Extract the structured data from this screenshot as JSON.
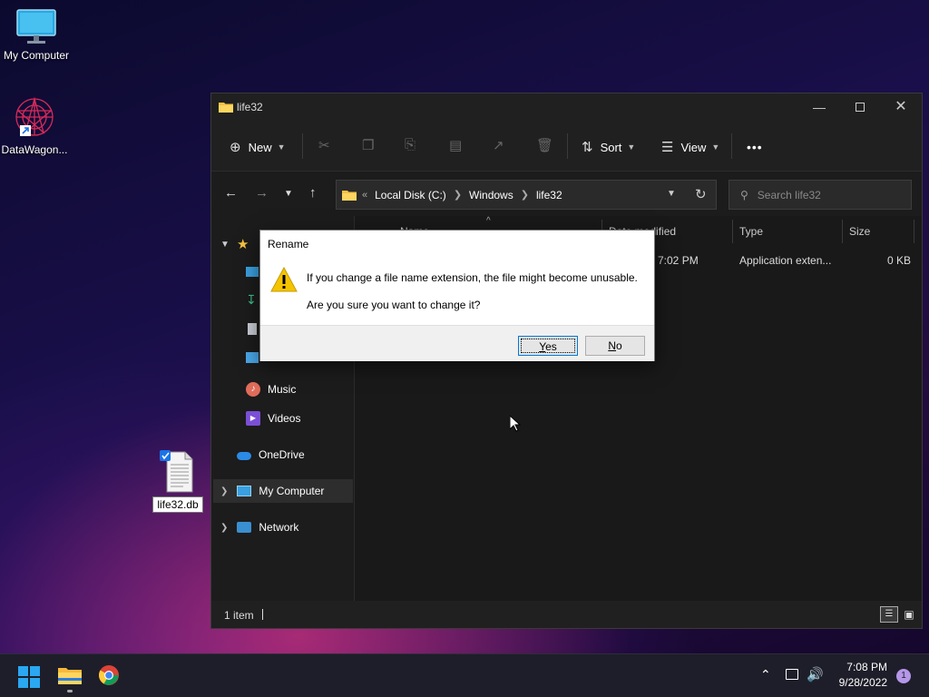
{
  "desktop": {
    "icons": [
      {
        "label": "My Computer"
      },
      {
        "label": "DataWagon..."
      },
      {
        "label": "life32.db"
      }
    ]
  },
  "explorer": {
    "title": "life32",
    "toolbar": {
      "new_label": "New",
      "sort_label": "Sort",
      "view_label": "View",
      "more_label": "•••"
    },
    "address": {
      "overflow": "«",
      "parts": [
        "Local Disk (C:)",
        "Windows",
        "life32"
      ]
    },
    "search": {
      "placeholder": "Search life32"
    },
    "nav": {
      "items": [
        "Music",
        "Videos",
        "OneDrive",
        "My Computer",
        "Network"
      ]
    },
    "columns": [
      "Name",
      "Date modified",
      "Type",
      "Size"
    ],
    "rows": [
      {
        "date": "7:02 PM",
        "type": "Application exten...",
        "size": "0 KB"
      }
    ],
    "status": {
      "count": "1 item"
    }
  },
  "dialog": {
    "title": "Rename",
    "message": "If you change a file name extension, the file might become unusable.",
    "question": "Are you sure you want to change it?",
    "yes_accel": "Y",
    "yes_rest": "es",
    "no_accel": "N",
    "no_rest": "o"
  },
  "taskbar": {
    "time": "7:08 PM",
    "date": "9/28/2022",
    "notification_count": "1"
  },
  "colors": {
    "accent": "#0078d7",
    "folder": "#f6c244",
    "notification_badge": "#b597e8"
  }
}
